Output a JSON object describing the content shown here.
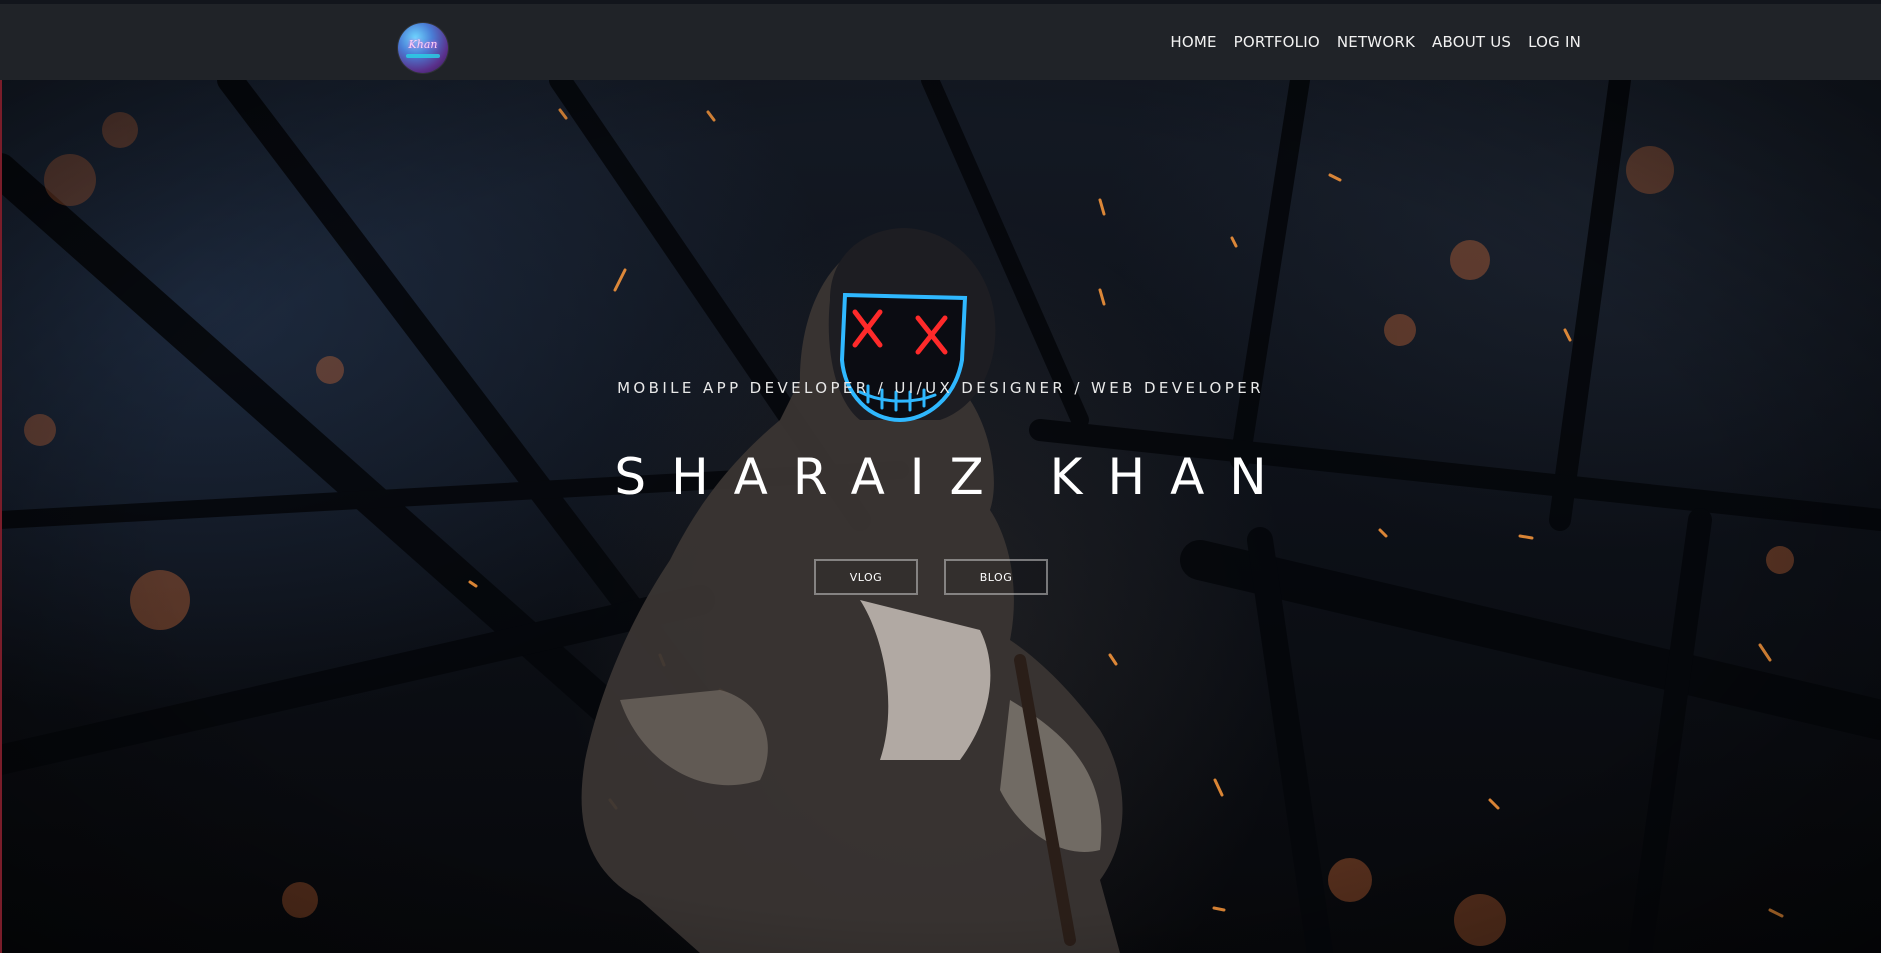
{
  "navbar": {
    "logo_text": "Khan",
    "links": [
      {
        "label": "HOME"
      },
      {
        "label": "PORTFOLIO"
      },
      {
        "label": "NETWORK"
      },
      {
        "label": "ABOUT US"
      },
      {
        "label": "LOG IN"
      }
    ]
  },
  "hero": {
    "subtitle": "MOBILE APP DEVELOPER / UI/UX DESIGNER / WEB DEVELOPER",
    "title": "SHARAIZ KHAN",
    "buttons": [
      {
        "label": "VLOG"
      },
      {
        "label": "BLOG"
      }
    ]
  },
  "colors": {
    "navbar_bg": "#202328",
    "mask_neon_blue": "#2fb8ff",
    "mask_neon_red": "#ff2a2a",
    "ember": "#ff8a2a"
  }
}
